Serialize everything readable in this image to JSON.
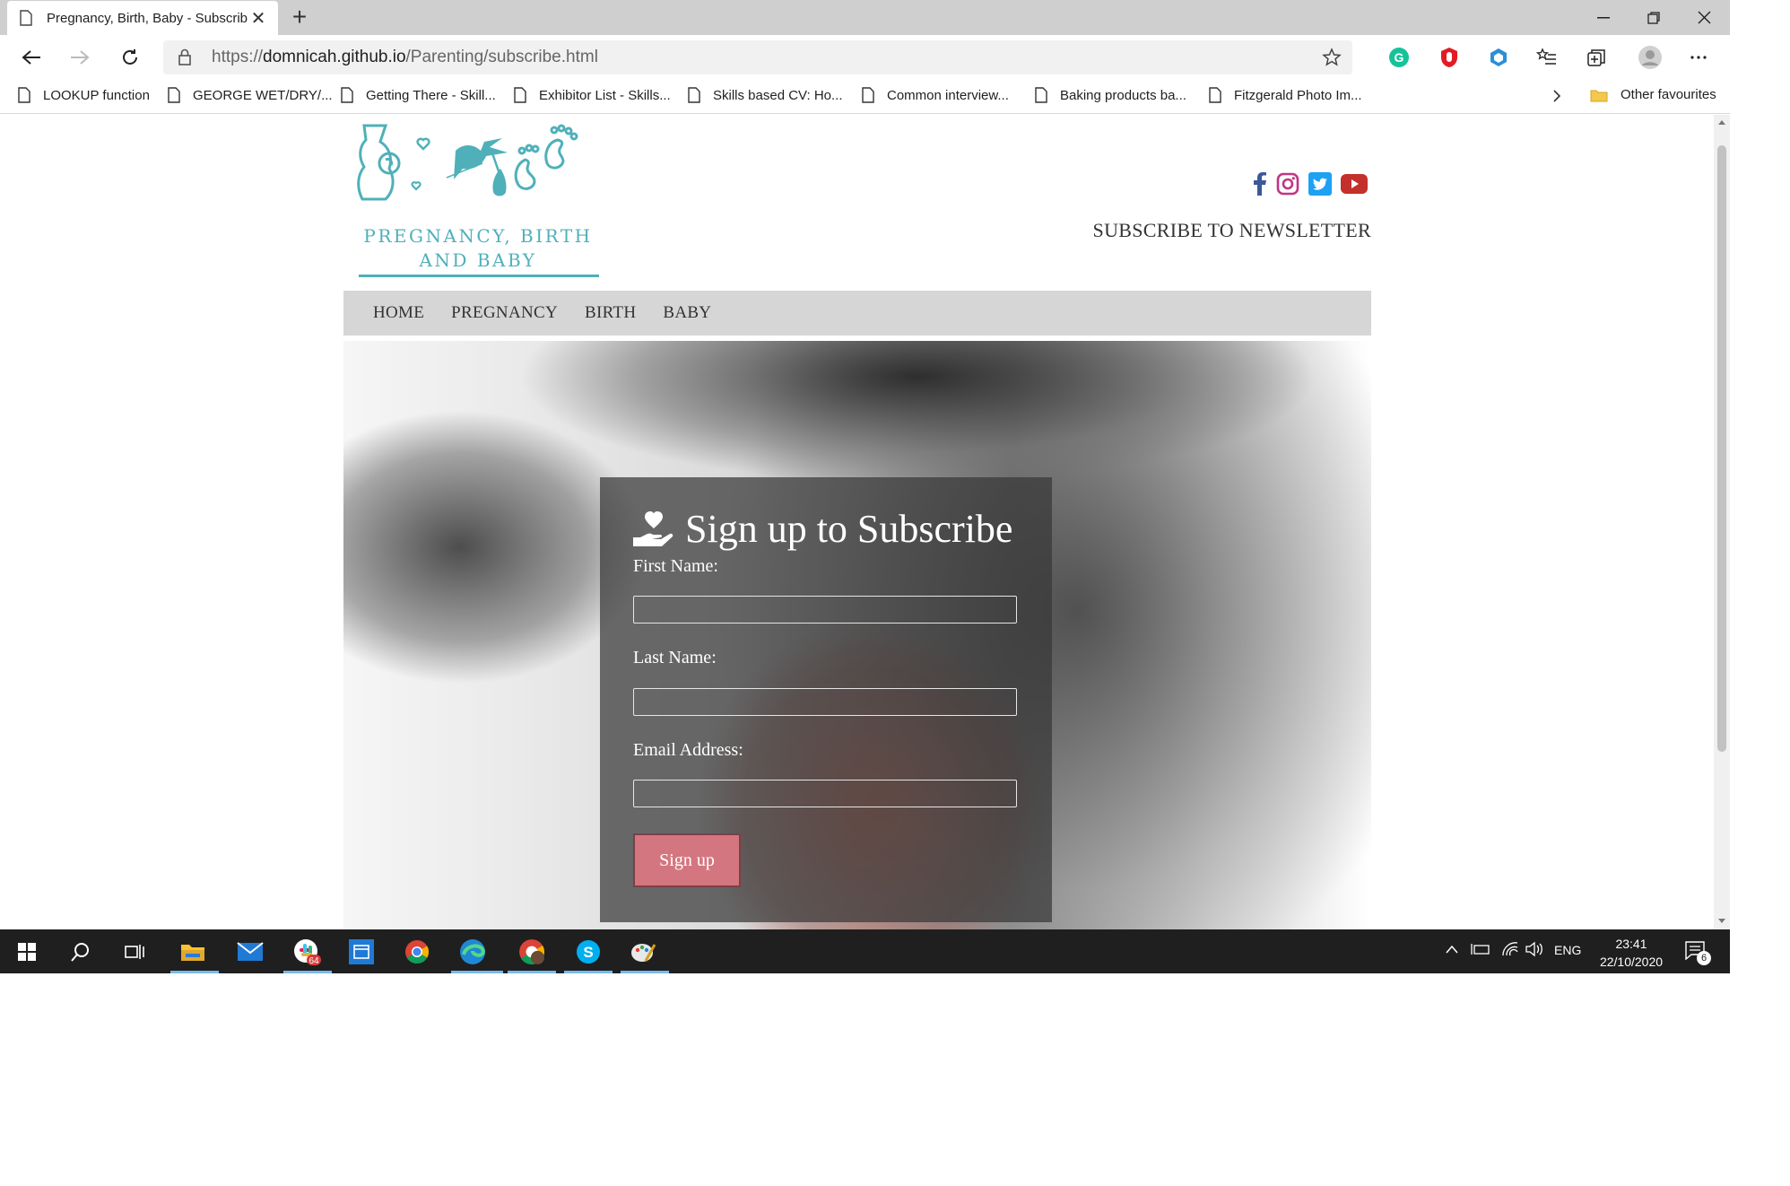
{
  "browser": {
    "tab_title": "Pregnancy, Birth, Baby - Subscrib",
    "url_prefix": "https://",
    "url_host": "domnicah.github.io",
    "url_path": "/Parenting/subscribe.html",
    "bookmarks": [
      "LOOKUP function",
      "GEORGE WET/DRY/...",
      "Getting There - Skill...",
      "Exhibitor List - Skills...",
      "Skills based CV: Ho...",
      "Common interview...",
      "Baking products ba...",
      "Fitzgerald Photo Im..."
    ],
    "other_favourites": "Other favourites"
  },
  "site": {
    "logo_line1": "PREGNANCY, BIRTH",
    "logo_line2": "AND BABY",
    "subscribe_link": "SUBSCRIBE TO NEWSLETTER",
    "nav": [
      "HOME",
      "PREGNANCY",
      "BIRTH",
      "BABY"
    ],
    "socials": [
      "facebook-icon",
      "instagram-icon",
      "twitter-icon",
      "youtube-icon"
    ],
    "colors": {
      "teal": "#4fb0b9",
      "button": "#d4767f",
      "navbar": "#d6d6d6"
    }
  },
  "signup": {
    "title": "Sign up to Subscribe",
    "first_name_label": "First Name:",
    "last_name_label": "Last Name:",
    "email_label": "Email Address:",
    "first_name_value": "",
    "last_name_value": "",
    "email_value": "",
    "button": "Sign up"
  },
  "taskbar": {
    "language": "ENG",
    "time": "23:41",
    "date": "22/10/2020",
    "notifications": "6",
    "slack_badge": "64"
  }
}
